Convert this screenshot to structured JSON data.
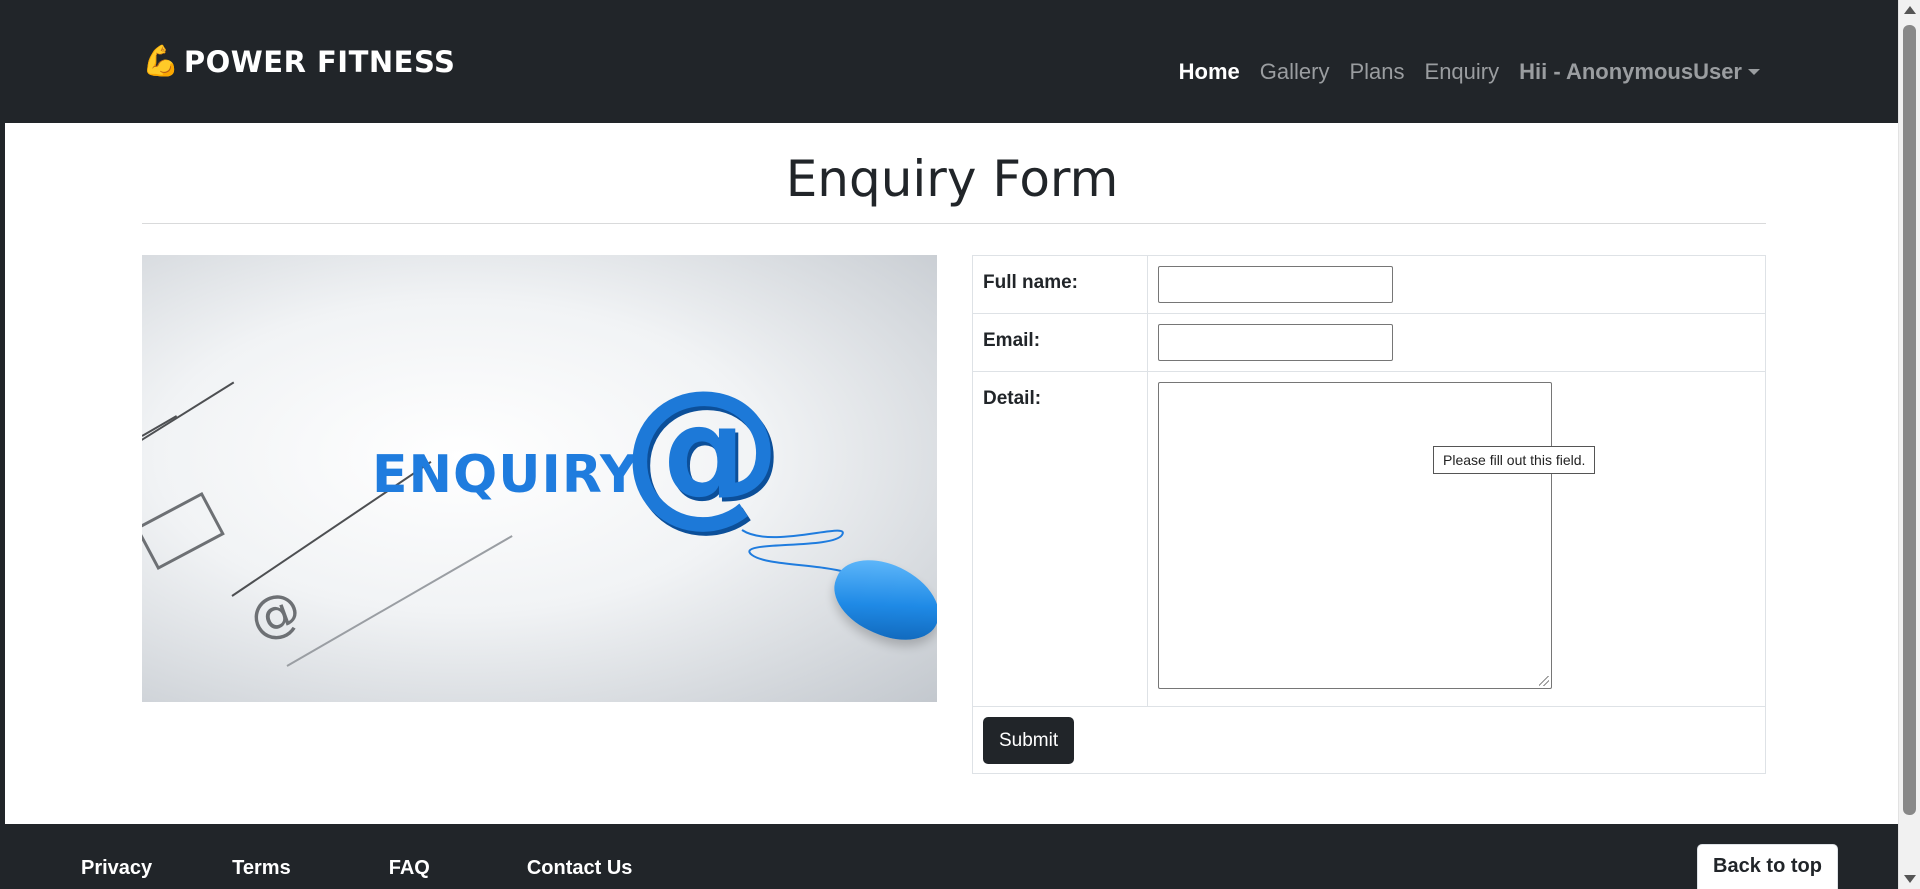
{
  "brand": {
    "name": "POWER FITNESS",
    "icon": "flexed-biceps-icon"
  },
  "nav": {
    "items": [
      {
        "label": "Home",
        "active": true
      },
      {
        "label": "Gallery",
        "active": false
      },
      {
        "label": "Plans",
        "active": false
      },
      {
        "label": "Enquiry",
        "active": false
      }
    ],
    "user_label": "Hii - AnonymousUser"
  },
  "page": {
    "title": "Enquiry Form"
  },
  "illustration": {
    "word": "ENQUIRY",
    "at_symbol": "@"
  },
  "form": {
    "fields": [
      {
        "label": "Full name:",
        "value": ""
      },
      {
        "label": "Email:",
        "value": ""
      },
      {
        "label": "Detail:",
        "value": ""
      }
    ],
    "validation_tooltip": "Please fill out this field.",
    "submit_label": "Submit"
  },
  "footer": {
    "links": [
      "Privacy",
      "Terms",
      "FAQ",
      "Contact Us"
    ],
    "back_to_top": "Back to top"
  },
  "colors": {
    "dark": "#212529",
    "nav_muted": "#9a9da0",
    "accent_blue": "#1f7cde"
  }
}
